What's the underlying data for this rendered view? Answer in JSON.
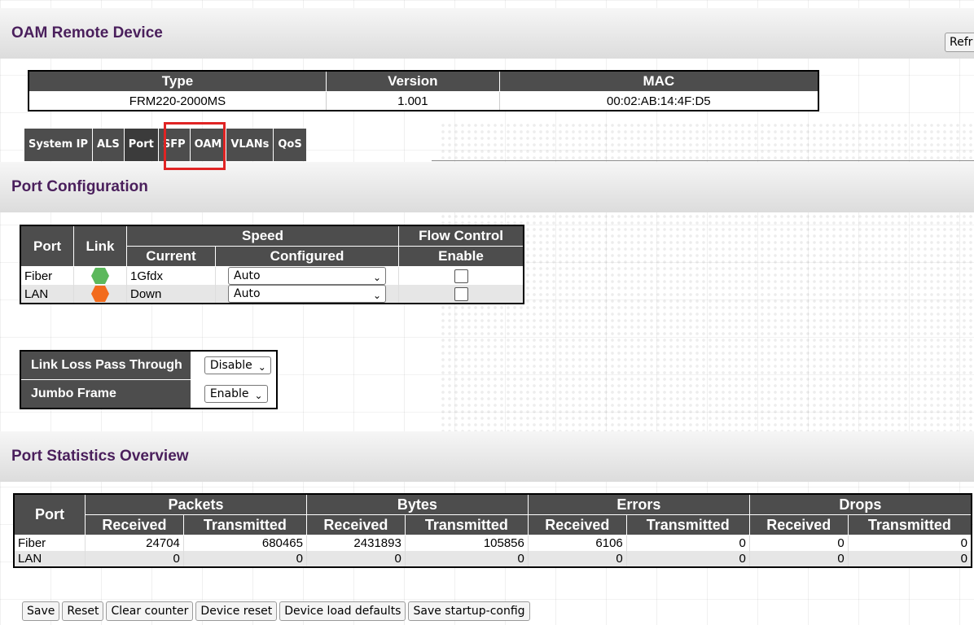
{
  "header": {
    "title": "OAM Remote Device",
    "refresh_label": "Refr"
  },
  "device": {
    "headers": [
      "Type",
      "Version",
      "MAC"
    ],
    "row": [
      "FRM220-2000MS",
      "1.001",
      "00:02:AB:14:4F:D5"
    ]
  },
  "tabs": [
    {
      "label": "System IP"
    },
    {
      "label": "ALS"
    },
    {
      "label": "Port",
      "active": true
    },
    {
      "label": "SFP"
    },
    {
      "label": "OAM"
    },
    {
      "label": "VLANs"
    },
    {
      "label": "QoS"
    }
  ],
  "port_config": {
    "title": "Port Configuration",
    "headers": {
      "port": "Port",
      "link": "Link",
      "speed": "Speed",
      "flow": "Flow Control",
      "current": "Current",
      "configured": "Configured",
      "enable": "Enable"
    },
    "rows": [
      {
        "port": "Fiber",
        "link_status": "up",
        "link_color": "#5cb85c",
        "current": "1Gfdx",
        "configured": "Auto",
        "flow_enabled": false
      },
      {
        "port": "LAN",
        "link_status": "down",
        "link_color": "#f26b1d",
        "current": "Down",
        "configured": "Auto",
        "flow_enabled": false
      }
    ]
  },
  "misc": {
    "link_loss_label": "Link Loss Pass Through",
    "link_loss_value": "Disable",
    "jumbo_label": "Jumbo Frame",
    "jumbo_value": "Enable"
  },
  "stats": {
    "title": "Port Statistics Overview",
    "headers": {
      "port": "Port",
      "packets": "Packets",
      "bytes": "Bytes",
      "errors": "Errors",
      "drops": "Drops",
      "received": "Received",
      "transmitted": "Transmitted"
    },
    "rows": [
      {
        "port": "Fiber",
        "values": [
          "24704",
          "680465",
          "2431893",
          "105856",
          "6106",
          "0",
          "0",
          "0"
        ]
      },
      {
        "port": "LAN",
        "values": [
          "0",
          "0",
          "0",
          "0",
          "0",
          "0",
          "0",
          "0"
        ]
      }
    ]
  },
  "actions": {
    "save": "Save",
    "reset": "Reset",
    "clear_counter": "Clear counter",
    "device_reset": "Device reset",
    "device_load_defaults": "Device load defaults",
    "save_startup_config": "Save startup-config"
  },
  "colors": {
    "header_text": "#4a1f5c",
    "table_header_bg": "#4d4d4d",
    "highlight": "#e02424"
  }
}
